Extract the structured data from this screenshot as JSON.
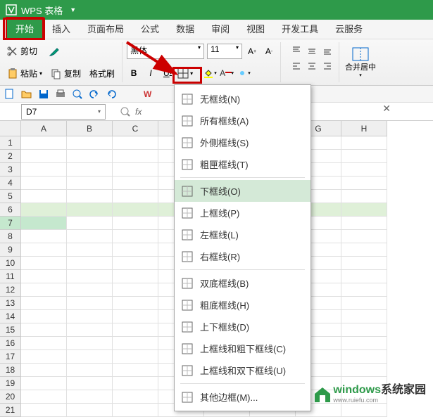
{
  "title": "WPS 表格",
  "tabs": [
    "开始",
    "插入",
    "页面布局",
    "公式",
    "数据",
    "审阅",
    "视图",
    "开发工具",
    "云服务"
  ],
  "active_tab_index": 0,
  "clipboard": {
    "cut": "剪切",
    "copy": "复制",
    "paste": "粘贴",
    "format_painter": "格式刷"
  },
  "font": {
    "name": "黑体",
    "size": "11"
  },
  "merge": {
    "label": "合并居中"
  },
  "cell_ref": "D7",
  "columns": [
    "A",
    "B",
    "C",
    "",
    "",
    "",
    "G",
    "H"
  ],
  "row_count": 21,
  "selected_row": 7,
  "highlight_row": 6,
  "border_menu": {
    "items": [
      {
        "label": "无框线(N)",
        "icon": "none"
      },
      {
        "label": "所有框线(A)",
        "icon": "all"
      },
      {
        "label": "外侧框线(S)",
        "icon": "outer"
      },
      {
        "label": "粗匣框线(T)",
        "icon": "thick"
      },
      {
        "sep": true
      },
      {
        "label": "下框线(O)",
        "icon": "bottom",
        "highlighted": true
      },
      {
        "label": "上框线(P)",
        "icon": "top"
      },
      {
        "label": "左框线(L)",
        "icon": "left"
      },
      {
        "label": "右框线(R)",
        "icon": "right"
      },
      {
        "sep": true
      },
      {
        "label": "双底框线(B)",
        "icon": "double-bottom"
      },
      {
        "label": "粗底框线(H)",
        "icon": "thick-bottom"
      },
      {
        "label": "上下框线(D)",
        "icon": "top-bottom"
      },
      {
        "label": "上框线和粗下框线(C)",
        "icon": "top-thick-bottom"
      },
      {
        "label": "上框线和双下框线(U)",
        "icon": "top-double-bottom"
      },
      {
        "sep": true
      },
      {
        "label": "其他边框(M)...",
        "icon": "more"
      }
    ]
  },
  "watermark": {
    "text1": "windows",
    "text2": "系统家园",
    "sub": "www.ruiefu.com"
  }
}
